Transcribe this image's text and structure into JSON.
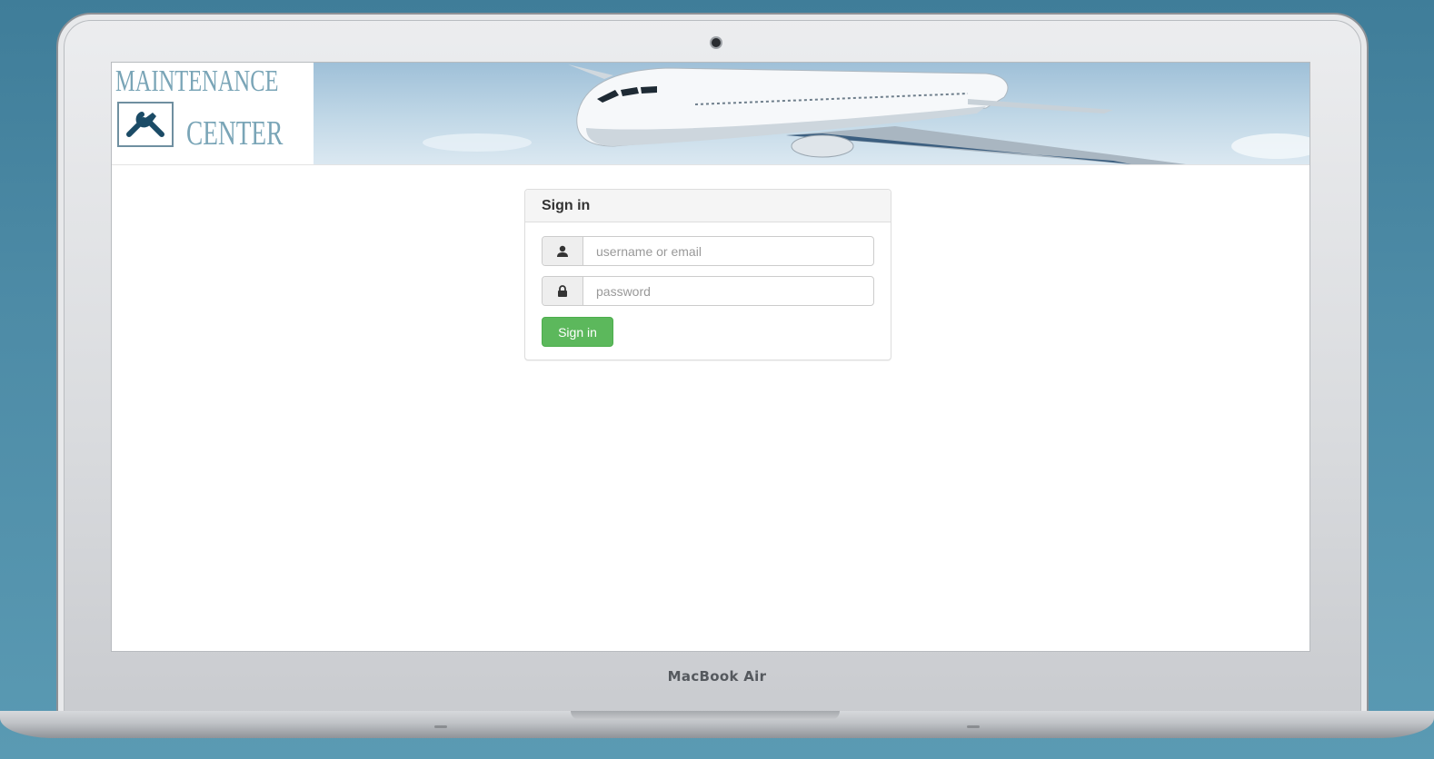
{
  "device": {
    "brand_label": "MacBook Air"
  },
  "header": {
    "logo": {
      "line1": "MAINTENANCE",
      "line2": "CENTER",
      "icon": "tools-icon"
    }
  },
  "signin_panel": {
    "title": "Sign in",
    "username": {
      "placeholder": "username or email",
      "value": "",
      "icon": "user-icon"
    },
    "password": {
      "placeholder": "password",
      "value": "",
      "icon": "lock-icon"
    },
    "submit_label": "Sign in"
  },
  "colors": {
    "accent_green": "#5cb85c",
    "logo_text": "#7aa5b7",
    "background": "#4d8ba6"
  }
}
